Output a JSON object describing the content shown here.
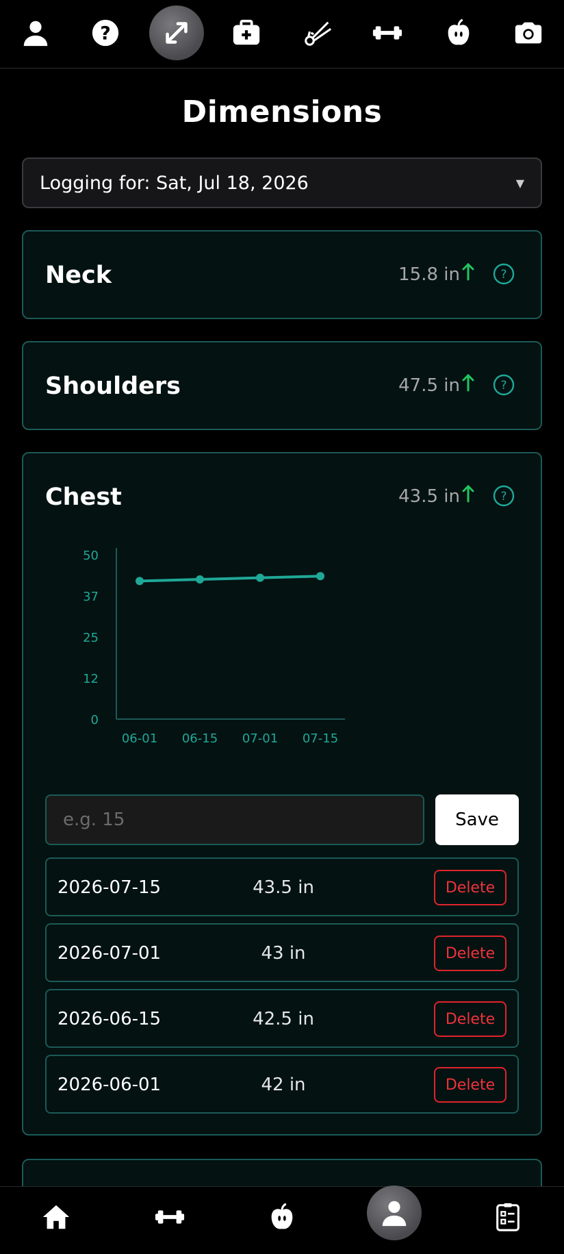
{
  "page": {
    "title": "Dimensions"
  },
  "date_select": {
    "label": "Logging for: Sat, Jul 18, 2026"
  },
  "top_nav": [
    "profile-icon",
    "help-icon",
    "dimensions-icon",
    "medical-kit-icon",
    "caliper-icon",
    "dumbbell-icon",
    "apple-icon",
    "camera-icon"
  ],
  "bottom_nav": [
    "home-icon",
    "dumbbell-icon",
    "apple-icon",
    "profile-icon",
    "checklist-icon"
  ],
  "colors": {
    "accent": "#1fa897",
    "up": "#22c55e",
    "danger": "#e0242c",
    "card_border": "#1b5a57"
  },
  "measurements": [
    {
      "name": "Neck",
      "value": "15.8 in",
      "trend": "up"
    },
    {
      "name": "Shoulders",
      "value": "47.5 in",
      "trend": "up"
    },
    {
      "name": "Chest",
      "value": "43.5 in",
      "trend": "up"
    }
  ],
  "chest": {
    "input_placeholder": "e.g. 15",
    "save_label": "Save",
    "delete_label": "Delete",
    "entries": [
      {
        "date": "2026-07-15",
        "value": "43.5 in"
      },
      {
        "date": "2026-07-01",
        "value": "43 in"
      },
      {
        "date": "2026-06-15",
        "value": "42.5 in"
      },
      {
        "date": "2026-06-01",
        "value": "42 in"
      }
    ]
  },
  "chart_data": {
    "type": "line",
    "categories": [
      "06-01",
      "06-15",
      "07-01",
      "07-15"
    ],
    "values": [
      42,
      42.5,
      43,
      43.5
    ],
    "y_ticks": [
      "50",
      "37",
      "25",
      "12",
      "0"
    ],
    "ylim": [
      0,
      50
    ],
    "grid": false
  }
}
